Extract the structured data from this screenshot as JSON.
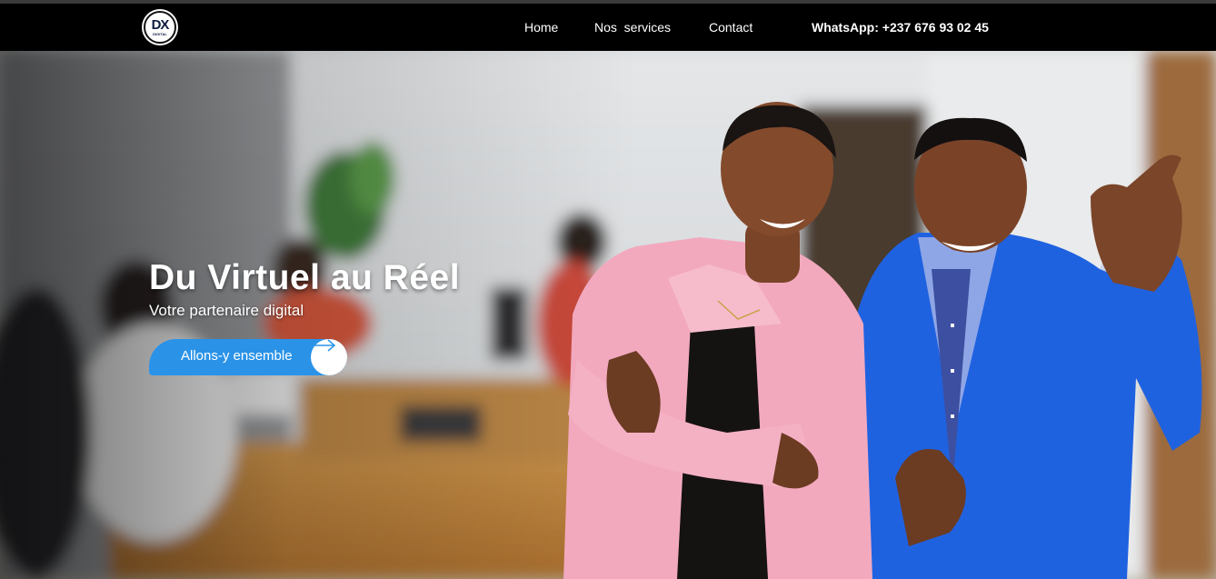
{
  "navbar": {
    "logo_icon": "dx-digital-logo",
    "logo_mark": "DX",
    "logo_sub": "DIGITAL",
    "links": [
      {
        "label": "Home"
      },
      {
        "label": "Nos  services"
      },
      {
        "label": "Contact"
      }
    ],
    "whatsapp": "WhatsApp: +237 676 93 02 45"
  },
  "hero": {
    "title": "Du Virtuel au Réel",
    "subtitle": "Votre partenaire digital",
    "cta_label": "Allons-y ensemble",
    "cta_icon": "arrow-right-icon",
    "image": "two-smiling-professionals-office-background"
  },
  "colors": {
    "accent": "#2a93e8",
    "navbar": "#000000",
    "pink_blazer": "#f2a9be",
    "blue_blazer": "#1f62e0"
  }
}
